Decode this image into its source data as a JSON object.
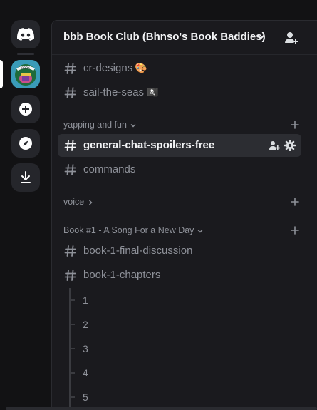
{
  "app": {
    "accent": "#5865f2"
  },
  "rail": {
    "home_icon": "discord-logo-icon",
    "server_icon": "book-club-server-icon",
    "add_icon": "plus-circle-icon",
    "discover_icon": "compass-icon",
    "download_icon": "download-icon"
  },
  "header": {
    "server_name": "bbb Book Club (Bhnso's Book Baddies)",
    "invite_icon": "add-member-icon"
  },
  "channels_top": [
    {
      "name": "cr-designs",
      "emoji": "🎨"
    },
    {
      "name": "sail-the-seas",
      "emoji": "🏴‍☠️"
    }
  ],
  "categories": [
    {
      "name": "yapping and fun",
      "channels": [
        {
          "name": "general-chat-spoilers-free",
          "active": true
        },
        {
          "name": "commands"
        }
      ]
    },
    {
      "name": "voice",
      "collapsed": true,
      "channels": []
    },
    {
      "name": "Book #1 - A Song For a New Day",
      "channels": [
        {
          "name": "book-1-final-discussion"
        },
        {
          "name": "book-1-chapters"
        }
      ]
    }
  ],
  "threads": [
    "1",
    "2",
    "3",
    "4",
    "5"
  ]
}
